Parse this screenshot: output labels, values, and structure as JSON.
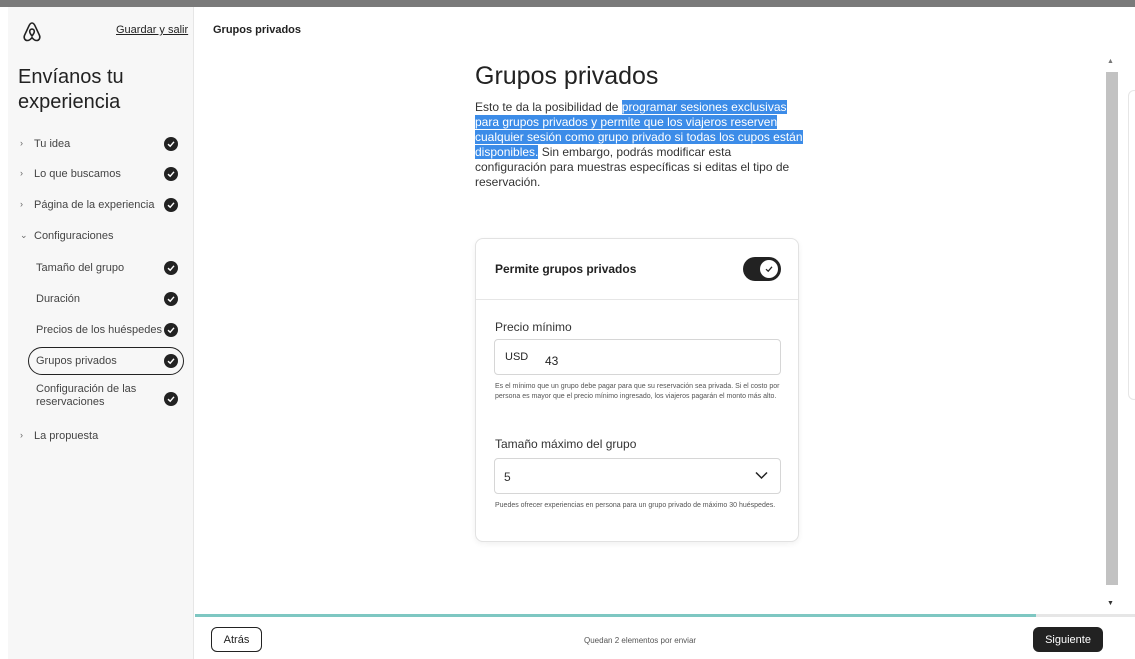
{
  "sidebar": {
    "save_exit": "Guardar y salir",
    "title": "Envíanos tu experiencia",
    "items": [
      {
        "label": "Tu idea",
        "done": true
      },
      {
        "label": "Lo que buscamos",
        "done": true
      },
      {
        "label": "Página de la experiencia",
        "done": true
      },
      {
        "label": "Configuraciones",
        "done": false
      },
      {
        "label": "Tamaño del grupo",
        "done": true
      },
      {
        "label": "Duración",
        "done": true
      },
      {
        "label": "Precios de los huéspedes",
        "done": true
      },
      {
        "label": "Grupos privados",
        "done": true
      },
      {
        "label": "Configuración de las reservaciones",
        "done": true
      },
      {
        "label": "La propuesta",
        "done": false
      }
    ]
  },
  "header": {
    "title": "Grupos privados"
  },
  "content": {
    "title": "Grupos privados",
    "desc_pre": "Esto te da la posibilidad de ",
    "desc_highlight": "programar sesiones exclusivas para grupos privados y permite que los viajeros reserven cualquier sesión como grupo privado si todas los cupos están disponibles.",
    "desc_post": " Sin embargo, podrás modificar esta configuración para muestras específicas si editas el tipo de reservación."
  },
  "card": {
    "toggle_label": "Permite grupos privados",
    "toggle_on": true,
    "price_label": "Precio mínimo",
    "currency": "USD",
    "price_value": "43",
    "price_help": "Es el mínimo que un grupo debe pagar para que su reservación sea privada. Si el costo por persona es mayor que el precio mínimo ingresado, los viajeros pagarán el monto más alto.",
    "group_size_label": "Tamaño máximo del grupo",
    "group_size_value": "5",
    "group_size_help": "Puedes ofrecer experiencias en persona para un grupo privado de máximo 30 huéspedes."
  },
  "footer": {
    "back": "Atrás",
    "remaining": "Quedan 2 elementos por enviar",
    "next": "Siguiente",
    "progress_fraction": 0.895
  },
  "colors": {
    "highlight": "#3c8ce8",
    "progress": "#7ec7c2",
    "primary": "#222222",
    "brand": "#222222"
  }
}
